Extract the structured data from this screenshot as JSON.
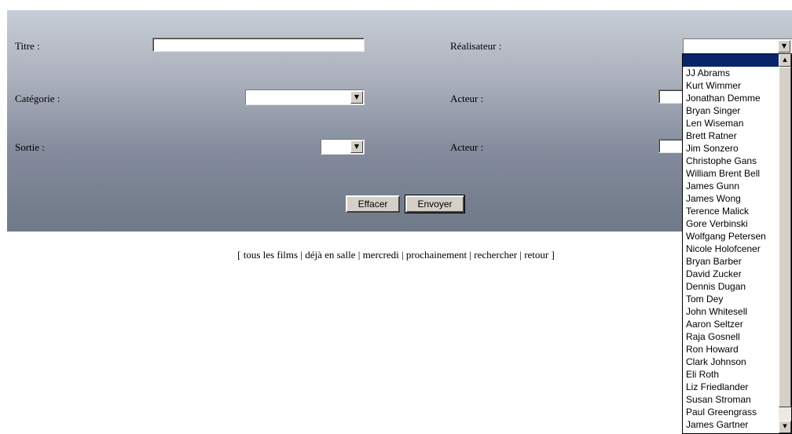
{
  "form": {
    "title_label": "Titre :",
    "director_label": "Réalisateur :",
    "category_label": "Catégorie :",
    "actor1_label": "Acteur :",
    "release_label": "Sortie :",
    "actor2_label": "Acteur :",
    "title_value": "",
    "category_value": "",
    "release_value": "",
    "director_value": "",
    "clear_button": "Effacer",
    "submit_button": "Envoyer"
  },
  "nav": {
    "open": "[",
    "sep": "|",
    "close": "]",
    "links": [
      "tous les films",
      "déjà en salle",
      "mercredi",
      "prochainement",
      "rechercher",
      "retour"
    ]
  },
  "director_dropdown": {
    "options": [
      "",
      "JJ Abrams",
      "Kurt Wimmer",
      "Jonathan Demme",
      "Bryan Singer",
      "Len Wiseman",
      "Brett Ratner",
      "Jim Sonzero",
      "Christophe Gans",
      "William Brent Bell",
      "James Gunn",
      "James Wong",
      "Terence Malick",
      "Gore Verbinski",
      "Wolfgang Petersen",
      "Nicole Holofcener",
      "Bryan Barber",
      "David Zucker",
      "Dennis Dugan",
      "Tom Dey",
      "John Whitesell",
      "Aaron Seltzer",
      "Raja Gosnell",
      "Ron Howard",
      "Clark Johnson",
      "Eli Roth",
      "Liz Friedlander",
      "Susan Stroman",
      "Paul Greengrass",
      "James Gartner"
    ],
    "highlighted_index": 0
  },
  "icons": {
    "dropdown_arrow": "▼",
    "scroll_up": "▲",
    "scroll_down": "▼"
  },
  "colors": {
    "highlight": "#0a246a"
  }
}
